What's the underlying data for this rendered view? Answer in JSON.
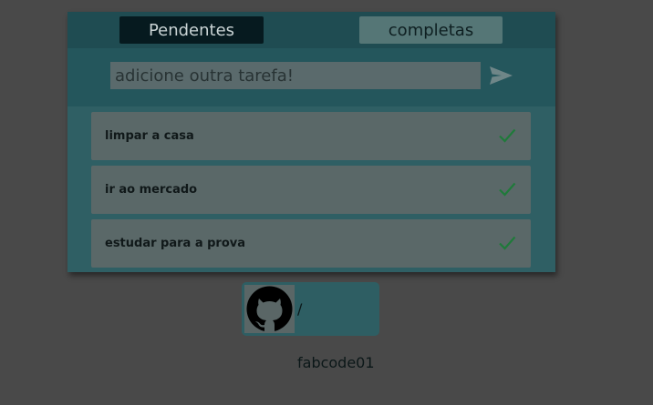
{
  "tabs": {
    "pending_label": "Pendentes",
    "done_label": "completas"
  },
  "input": {
    "placeholder": "adicione outra tarefa!",
    "send_icon": "send-arrow-icon"
  },
  "tasks": [
    {
      "label": "limpar a casa",
      "icon": "check-icon"
    },
    {
      "label": "ir ao mercado",
      "icon": "check-icon"
    },
    {
      "label": "estudar para a prova",
      "icon": "check-icon"
    }
  ],
  "footer": {
    "github_text": "/ fabcode01",
    "icon": "github-icon"
  },
  "colors": {
    "background": "#494949",
    "panel": "#2f5f64",
    "active_tab": "#061a1f",
    "check": "#1f7a3a"
  }
}
